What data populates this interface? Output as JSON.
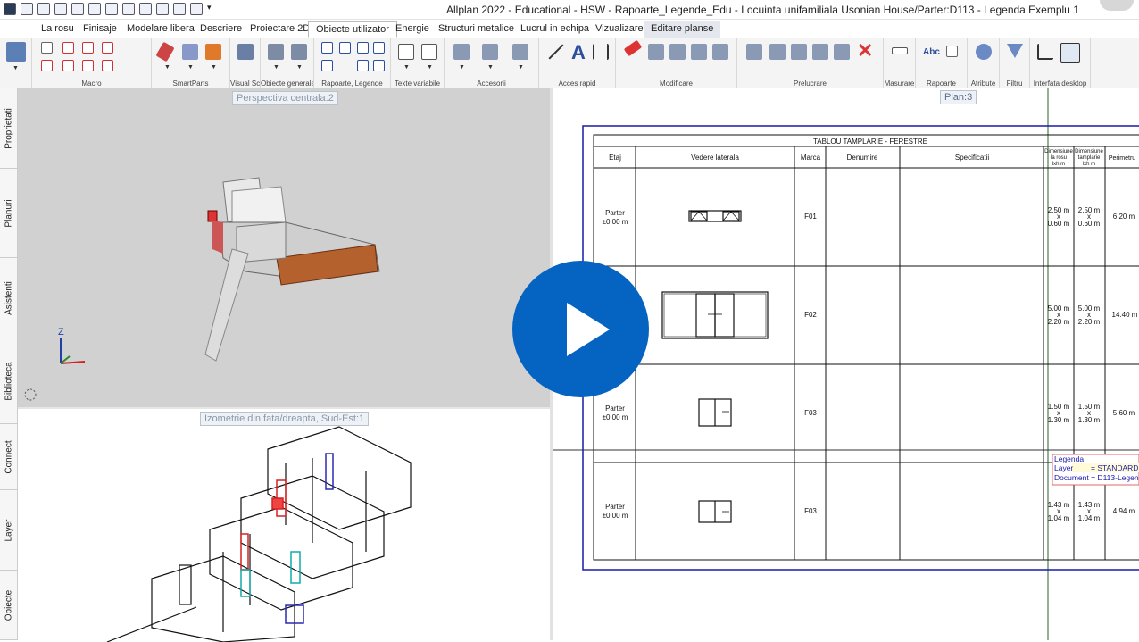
{
  "window": {
    "title": "Allplan 2022 - Educational - HSW - Rapoarte_Legende_Edu - Locuinta unifamiliala Usonian House/Parter:D113 - Legenda Exemplu 1"
  },
  "tabs": [
    {
      "label": "La rosu"
    },
    {
      "label": "Finisaje"
    },
    {
      "label": "Modelare libera"
    },
    {
      "label": "Descriere"
    },
    {
      "label": "Proiectare 2D"
    },
    {
      "label": "Obiecte utilizator"
    },
    {
      "label": "Energie"
    },
    {
      "label": "Structuri metalice"
    },
    {
      "label": "Lucrul in echipa"
    },
    {
      "label": "Vizualizare"
    },
    {
      "label": "Editare planse"
    }
  ],
  "ribbon": {
    "groups": [
      {
        "label": "Macro"
      },
      {
        "label": "SmartParts"
      },
      {
        "label": "Visual Sc..."
      },
      {
        "label": "Obiecte generale"
      },
      {
        "label": "Rapoarte, Legende"
      },
      {
        "label": "Texte variabile"
      },
      {
        "label": "Accesorii"
      },
      {
        "label": "Acces rapid"
      },
      {
        "label": "Modificare"
      },
      {
        "label": "Prelucrare"
      },
      {
        "label": "Masurare"
      },
      {
        "label": "Rapoarte"
      },
      {
        "label": "Atribute"
      },
      {
        "label": "Filtru"
      },
      {
        "label": "Interfata desktop"
      }
    ],
    "glyphs": {
      "text_tool": "A",
      "abc": "Abc"
    }
  },
  "side_tabs": [
    {
      "label": "Proprietati"
    },
    {
      "label": "Planuri"
    },
    {
      "label": "Asistenti"
    },
    {
      "label": "Biblioteca"
    },
    {
      "label": "Connect"
    },
    {
      "label": "Layer"
    },
    {
      "label": "Obiecte"
    }
  ],
  "viewports": {
    "top": {
      "label": "Perspectiva centrala:2",
      "axis_z": "Z"
    },
    "bottom": {
      "label": "Izometrie din fata/dreapta, Sud-Est:1"
    },
    "plan": {
      "label": "Plan:3"
    }
  },
  "table": {
    "title": "TABLOU TAMPLARIE - FERESTRE",
    "headers": {
      "etaj": "Etaj",
      "vedere": "Vedere laterala",
      "marca": "Marca",
      "denumire": "Denumire",
      "specificatii": "Specificatii",
      "dim1": [
        "Dimensiune",
        "la rosu",
        "lxh m"
      ],
      "dim2": [
        "Dimensiune",
        "tamplarie",
        "lxh m"
      ],
      "perimetru": "Perimetru"
    },
    "rows": [
      {
        "etaj": [
          "Parter",
          "±0.00 m"
        ],
        "marca": "F01",
        "dim1": [
          "2.50 m",
          "x",
          "0.60 m"
        ],
        "dim2": [
          "2.50 m",
          "x",
          "0.60 m"
        ],
        "perimetru": "6.20 m"
      },
      {
        "etaj": [
          "",
          ""
        ],
        "marca": "F02",
        "dim1": [
          "5.00 m",
          "x",
          "2.20 m"
        ],
        "dim2": [
          "5.00 m",
          "x",
          "2.20 m"
        ],
        "perimetru": "14.40 m"
      },
      {
        "etaj": [
          "Parter",
          "±0.00 m"
        ],
        "marca": "F03",
        "dim1": [
          "1.50 m",
          "x",
          "1.30 m"
        ],
        "dim2": [
          "1.50 m",
          "x",
          "1.30 m"
        ],
        "perimetru": "5.60 m"
      },
      {
        "etaj": [
          "Parter",
          "±0.00 m"
        ],
        "marca": "F03",
        "dim1": [
          "1.43 m",
          "x",
          "1.04 m"
        ],
        "dim2": [
          "1.43 m",
          "x",
          "1.04 m"
        ],
        "perimetru": "4.94 m"
      }
    ]
  },
  "legend_box": {
    "title": "Legenda",
    "layer": "Layer",
    "layer_val": "= STANDARD",
    "doc": "Document = D113-Legen"
  },
  "colors": {
    "accent": "#0563c1",
    "frame": "#1a1aa8",
    "wall": "#a0522d",
    "highlight": "#d62020"
  }
}
